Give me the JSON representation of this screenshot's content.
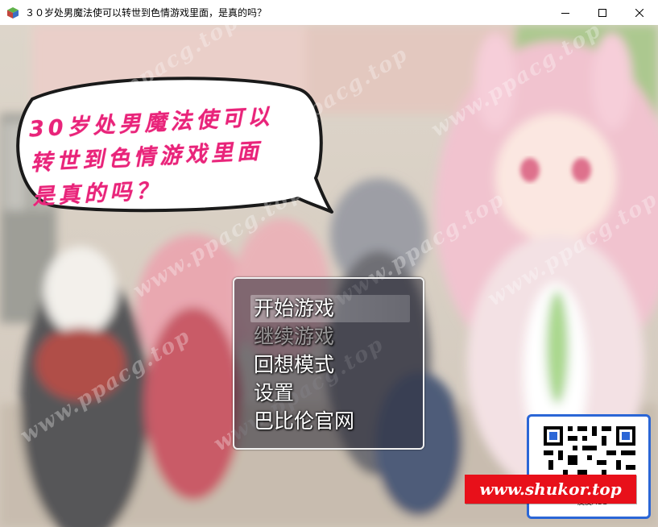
{
  "window": {
    "title": "３０岁处男魔法使可以转世到色情游戏里面，是真的吗？",
    "controls": [
      "minimize-icon",
      "maximize-icon",
      "close-icon"
    ]
  },
  "game": {
    "speech_bubble": {
      "line1": "30岁处男魔法使可以",
      "line2": "转世到色情游戏里面",
      "line3": "是真的吗？",
      "text_color": "#e8247a"
    },
    "watermark": "www.ppacg.top",
    "menu": {
      "items": [
        {
          "label": "开始游戏",
          "state": "selected"
        },
        {
          "label": "继续游戏",
          "state": "disabled"
        },
        {
          "label": "回想模式",
          "state": "normal"
        },
        {
          "label": "设置",
          "state": "normal"
        },
        {
          "label": "巴比伦官网",
          "state": "normal"
        }
      ]
    },
    "qr_badge": {
      "caption": "皮皮ACG",
      "site_url": "www.shukor.top",
      "banner_color": "#e8101a",
      "frame_color": "#2b66d6"
    }
  }
}
